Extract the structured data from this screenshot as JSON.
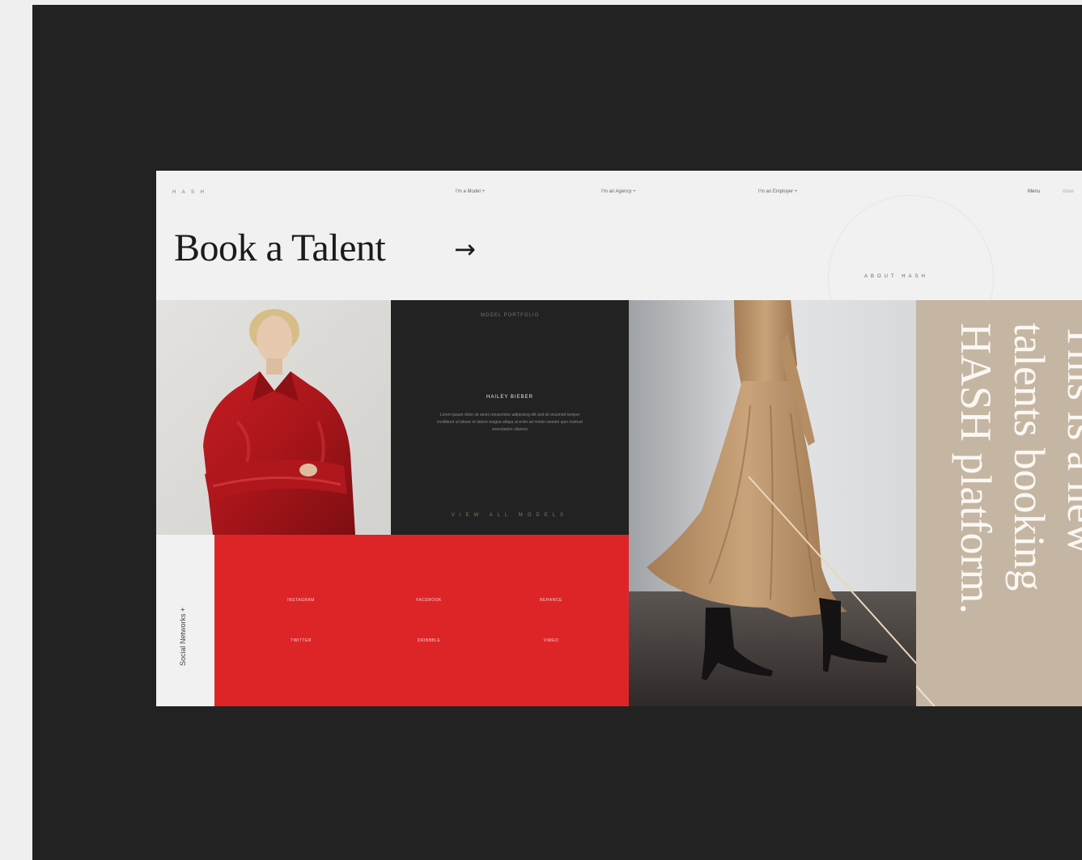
{
  "header": {
    "logo": "H A S H",
    "nav": [
      "I'm a Model +",
      "I'm an Agency +",
      "I'm an Employer +"
    ],
    "menu_label": "Menu",
    "close_label": "close"
  },
  "hero": {
    "title": "Book a Talent",
    "arrow": "→",
    "about_label": "ABOUT HASH"
  },
  "featured": {
    "top_label": "MODEL PORTFOLIO",
    "heading": "HAILEY BIEBER",
    "body": "Lorem ipsum dolor sit amet consectetur adipiscing elit sed do eiusmod tempor incididunt ut labore et dolore magna aliqua ut enim ad minim veniam quis nostrud exercitation ullamco",
    "view_all": "VIEW ALL MODELS"
  },
  "social": {
    "label": "Social Networks +",
    "links": [
      "INSTAGRAM",
      "FACEBOOK",
      "BEHANCE",
      "TWITTER",
      "DRIBBBLE",
      "VIMEO"
    ]
  },
  "tagline": [
    "This is a new",
    "talents booking",
    "HASH platform."
  ],
  "colors": {
    "stage": "#222222",
    "accent_red": "#dd2528",
    "beige": "#c5b6a4",
    "header_bg": "#f1f1f1"
  }
}
